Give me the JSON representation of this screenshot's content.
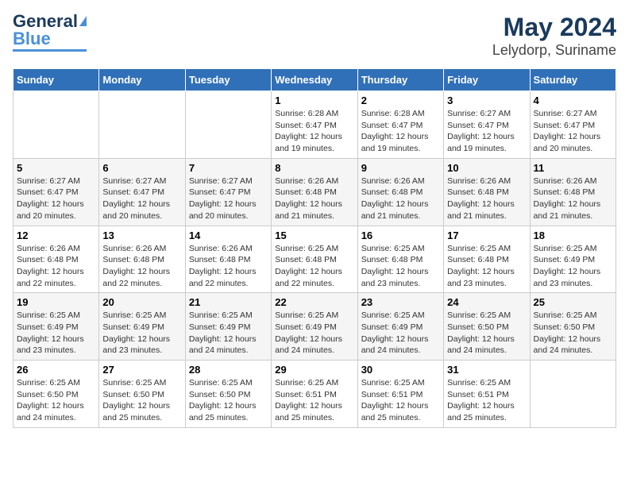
{
  "logo": {
    "line1": "General",
    "line2": "Blue"
  },
  "header": {
    "month": "May 2024",
    "location": "Lelydorp, Suriname"
  },
  "days_of_week": [
    "Sunday",
    "Monday",
    "Tuesday",
    "Wednesday",
    "Thursday",
    "Friday",
    "Saturday"
  ],
  "weeks": [
    [
      {
        "day": "",
        "sunrise": "",
        "sunset": "",
        "daylight": ""
      },
      {
        "day": "",
        "sunrise": "",
        "sunset": "",
        "daylight": ""
      },
      {
        "day": "",
        "sunrise": "",
        "sunset": "",
        "daylight": ""
      },
      {
        "day": "1",
        "sunrise": "Sunrise: 6:28 AM",
        "sunset": "Sunset: 6:47 PM",
        "daylight": "Daylight: 12 hours and 19 minutes."
      },
      {
        "day": "2",
        "sunrise": "Sunrise: 6:28 AM",
        "sunset": "Sunset: 6:47 PM",
        "daylight": "Daylight: 12 hours and 19 minutes."
      },
      {
        "day": "3",
        "sunrise": "Sunrise: 6:27 AM",
        "sunset": "Sunset: 6:47 PM",
        "daylight": "Daylight: 12 hours and 19 minutes."
      },
      {
        "day": "4",
        "sunrise": "Sunrise: 6:27 AM",
        "sunset": "Sunset: 6:47 PM",
        "daylight": "Daylight: 12 hours and 20 minutes."
      }
    ],
    [
      {
        "day": "5",
        "sunrise": "Sunrise: 6:27 AM",
        "sunset": "Sunset: 6:47 PM",
        "daylight": "Daylight: 12 hours and 20 minutes."
      },
      {
        "day": "6",
        "sunrise": "Sunrise: 6:27 AM",
        "sunset": "Sunset: 6:47 PM",
        "daylight": "Daylight: 12 hours and 20 minutes."
      },
      {
        "day": "7",
        "sunrise": "Sunrise: 6:27 AM",
        "sunset": "Sunset: 6:47 PM",
        "daylight": "Daylight: 12 hours and 20 minutes."
      },
      {
        "day": "8",
        "sunrise": "Sunrise: 6:26 AM",
        "sunset": "Sunset: 6:48 PM",
        "daylight": "Daylight: 12 hours and 21 minutes."
      },
      {
        "day": "9",
        "sunrise": "Sunrise: 6:26 AM",
        "sunset": "Sunset: 6:48 PM",
        "daylight": "Daylight: 12 hours and 21 minutes."
      },
      {
        "day": "10",
        "sunrise": "Sunrise: 6:26 AM",
        "sunset": "Sunset: 6:48 PM",
        "daylight": "Daylight: 12 hours and 21 minutes."
      },
      {
        "day": "11",
        "sunrise": "Sunrise: 6:26 AM",
        "sunset": "Sunset: 6:48 PM",
        "daylight": "Daylight: 12 hours and 21 minutes."
      }
    ],
    [
      {
        "day": "12",
        "sunrise": "Sunrise: 6:26 AM",
        "sunset": "Sunset: 6:48 PM",
        "daylight": "Daylight: 12 hours and 22 minutes."
      },
      {
        "day": "13",
        "sunrise": "Sunrise: 6:26 AM",
        "sunset": "Sunset: 6:48 PM",
        "daylight": "Daylight: 12 hours and 22 minutes."
      },
      {
        "day": "14",
        "sunrise": "Sunrise: 6:26 AM",
        "sunset": "Sunset: 6:48 PM",
        "daylight": "Daylight: 12 hours and 22 minutes."
      },
      {
        "day": "15",
        "sunrise": "Sunrise: 6:25 AM",
        "sunset": "Sunset: 6:48 PM",
        "daylight": "Daylight: 12 hours and 22 minutes."
      },
      {
        "day": "16",
        "sunrise": "Sunrise: 6:25 AM",
        "sunset": "Sunset: 6:48 PM",
        "daylight": "Daylight: 12 hours and 23 minutes."
      },
      {
        "day": "17",
        "sunrise": "Sunrise: 6:25 AM",
        "sunset": "Sunset: 6:48 PM",
        "daylight": "Daylight: 12 hours and 23 minutes."
      },
      {
        "day": "18",
        "sunrise": "Sunrise: 6:25 AM",
        "sunset": "Sunset: 6:49 PM",
        "daylight": "Daylight: 12 hours and 23 minutes."
      }
    ],
    [
      {
        "day": "19",
        "sunrise": "Sunrise: 6:25 AM",
        "sunset": "Sunset: 6:49 PM",
        "daylight": "Daylight: 12 hours and 23 minutes."
      },
      {
        "day": "20",
        "sunrise": "Sunrise: 6:25 AM",
        "sunset": "Sunset: 6:49 PM",
        "daylight": "Daylight: 12 hours and 23 minutes."
      },
      {
        "day": "21",
        "sunrise": "Sunrise: 6:25 AM",
        "sunset": "Sunset: 6:49 PM",
        "daylight": "Daylight: 12 hours and 24 minutes."
      },
      {
        "day": "22",
        "sunrise": "Sunrise: 6:25 AM",
        "sunset": "Sunset: 6:49 PM",
        "daylight": "Daylight: 12 hours and 24 minutes."
      },
      {
        "day": "23",
        "sunrise": "Sunrise: 6:25 AM",
        "sunset": "Sunset: 6:49 PM",
        "daylight": "Daylight: 12 hours and 24 minutes."
      },
      {
        "day": "24",
        "sunrise": "Sunrise: 6:25 AM",
        "sunset": "Sunset: 6:50 PM",
        "daylight": "Daylight: 12 hours and 24 minutes."
      },
      {
        "day": "25",
        "sunrise": "Sunrise: 6:25 AM",
        "sunset": "Sunset: 6:50 PM",
        "daylight": "Daylight: 12 hours and 24 minutes."
      }
    ],
    [
      {
        "day": "26",
        "sunrise": "Sunrise: 6:25 AM",
        "sunset": "Sunset: 6:50 PM",
        "daylight": "Daylight: 12 hours and 24 minutes."
      },
      {
        "day": "27",
        "sunrise": "Sunrise: 6:25 AM",
        "sunset": "Sunset: 6:50 PM",
        "daylight": "Daylight: 12 hours and 25 minutes."
      },
      {
        "day": "28",
        "sunrise": "Sunrise: 6:25 AM",
        "sunset": "Sunset: 6:50 PM",
        "daylight": "Daylight: 12 hours and 25 minutes."
      },
      {
        "day": "29",
        "sunrise": "Sunrise: 6:25 AM",
        "sunset": "Sunset: 6:51 PM",
        "daylight": "Daylight: 12 hours and 25 minutes."
      },
      {
        "day": "30",
        "sunrise": "Sunrise: 6:25 AM",
        "sunset": "Sunset: 6:51 PM",
        "daylight": "Daylight: 12 hours and 25 minutes."
      },
      {
        "day": "31",
        "sunrise": "Sunrise: 6:25 AM",
        "sunset": "Sunset: 6:51 PM",
        "daylight": "Daylight: 12 hours and 25 minutes."
      },
      {
        "day": "",
        "sunrise": "",
        "sunset": "",
        "daylight": ""
      }
    ]
  ]
}
